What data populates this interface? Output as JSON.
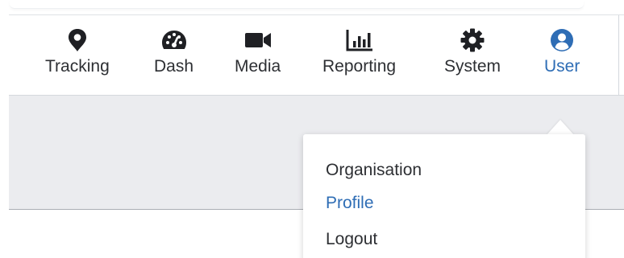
{
  "nav": {
    "items": [
      {
        "label": "Tracking",
        "icon": "map-marker-icon"
      },
      {
        "label": "Dash",
        "icon": "speedometer-icon"
      },
      {
        "label": "Media",
        "icon": "video-camera-icon"
      },
      {
        "label": "Reporting",
        "icon": "bar-chart-icon"
      },
      {
        "label": "System",
        "icon": "gear-icon"
      },
      {
        "label": "User",
        "icon": "user-circle-icon",
        "active": true
      }
    ]
  },
  "user_menu": {
    "items": [
      {
        "label": "Organisation"
      },
      {
        "label": "Profile",
        "highlighted": true
      },
      {
        "label": "Logout"
      }
    ]
  },
  "colors": {
    "text": "#2d2f33",
    "accent": "#2e6db5",
    "content_bg": "#ebecef"
  }
}
